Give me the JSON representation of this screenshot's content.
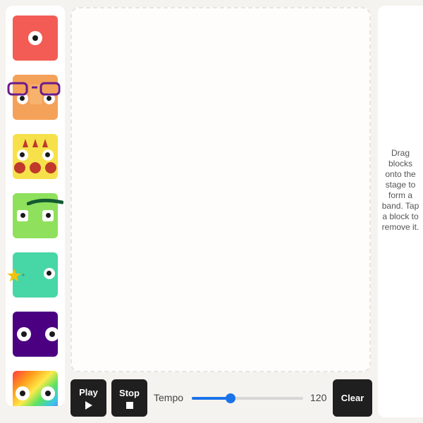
{
  "palette": {
    "blocks": [
      {
        "name": "red-one-eye",
        "color": "#f25c54"
      },
      {
        "name": "orange-glasses",
        "color": "#f4a259"
      },
      {
        "name": "yellow-spikes",
        "color": "#f7e14b"
      },
      {
        "name": "green-unibrow",
        "color": "#8fe05c"
      },
      {
        "name": "teal-star",
        "color": "#47d6a5"
      },
      {
        "name": "purple-eyes",
        "color": "#4b0082"
      },
      {
        "name": "rainbow",
        "color": "#ff6b6b"
      }
    ]
  },
  "controls": {
    "play_label": "Play",
    "stop_label": "Stop",
    "tempo_label": "Tempo",
    "tempo_value": "120",
    "tempo_fraction": 0.35,
    "clear_label": "Clear"
  },
  "help": {
    "text": "Drag blocks onto the stage to form a band. Tap a block to remove it."
  },
  "colors": {
    "accent": "#1a73e8",
    "button": "#1f1f1f"
  }
}
